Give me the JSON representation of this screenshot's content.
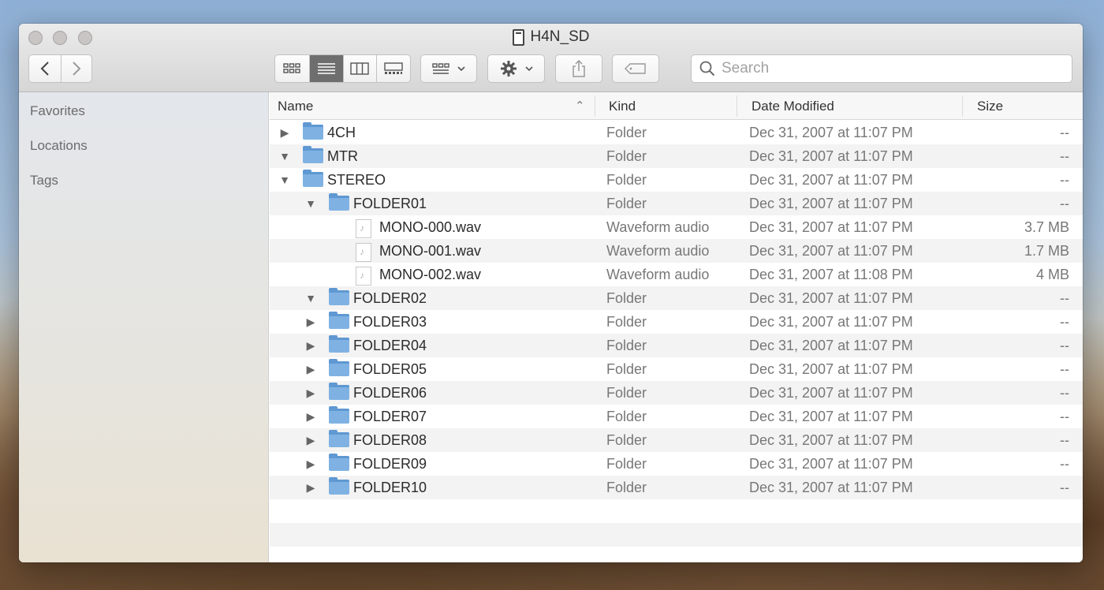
{
  "window": {
    "title": "H4N_SD"
  },
  "toolbar": {
    "back_icon": "chevron-left-icon",
    "forward_icon": "chevron-right-icon",
    "search_placeholder": "Search"
  },
  "sidebar": {
    "sections": [
      {
        "label": "Favorites"
      },
      {
        "label": "Locations"
      },
      {
        "label": "Tags"
      }
    ]
  },
  "columns": {
    "name": "Name",
    "kind": "Kind",
    "date": "Date Modified",
    "size": "Size"
  },
  "rows": [
    {
      "name": "4CH",
      "kind": "Folder",
      "date": "Dec 31, 2007 at 11:07 PM",
      "size": "--",
      "type": "folder",
      "level": 0,
      "expanded": false
    },
    {
      "name": "MTR",
      "kind": "Folder",
      "date": "Dec 31, 2007 at 11:07 PM",
      "size": "--",
      "type": "folder",
      "level": 0,
      "expanded": true
    },
    {
      "name": "STEREO",
      "kind": "Folder",
      "date": "Dec 31, 2007 at 11:07 PM",
      "size": "--",
      "type": "folder",
      "level": 0,
      "expanded": true
    },
    {
      "name": "FOLDER01",
      "kind": "Folder",
      "date": "Dec 31, 2007 at 11:07 PM",
      "size": "--",
      "type": "folder",
      "level": 1,
      "expanded": true
    },
    {
      "name": "MONO-000.wav",
      "kind": "Waveform audio",
      "date": "Dec 31, 2007 at 11:07 PM",
      "size": "3.7 MB",
      "type": "file",
      "level": 2
    },
    {
      "name": "MONO-001.wav",
      "kind": "Waveform audio",
      "date": "Dec 31, 2007 at 11:07 PM",
      "size": "1.7 MB",
      "type": "file",
      "level": 2
    },
    {
      "name": "MONO-002.wav",
      "kind": "Waveform audio",
      "date": "Dec 31, 2007 at 11:08 PM",
      "size": "4 MB",
      "type": "file",
      "level": 2
    },
    {
      "name": "FOLDER02",
      "kind": "Folder",
      "date": "Dec 31, 2007 at 11:07 PM",
      "size": "--",
      "type": "folder",
      "level": 1,
      "expanded": true
    },
    {
      "name": "FOLDER03",
      "kind": "Folder",
      "date": "Dec 31, 2007 at 11:07 PM",
      "size": "--",
      "type": "folder",
      "level": 1,
      "expanded": false
    },
    {
      "name": "FOLDER04",
      "kind": "Folder",
      "date": "Dec 31, 2007 at 11:07 PM",
      "size": "--",
      "type": "folder",
      "level": 1,
      "expanded": false
    },
    {
      "name": "FOLDER05",
      "kind": "Folder",
      "date": "Dec 31, 2007 at 11:07 PM",
      "size": "--",
      "type": "folder",
      "level": 1,
      "expanded": false
    },
    {
      "name": "FOLDER06",
      "kind": "Folder",
      "date": "Dec 31, 2007 at 11:07 PM",
      "size": "--",
      "type": "folder",
      "level": 1,
      "expanded": false
    },
    {
      "name": "FOLDER07",
      "kind": "Folder",
      "date": "Dec 31, 2007 at 11:07 PM",
      "size": "--",
      "type": "folder",
      "level": 1,
      "expanded": false
    },
    {
      "name": "FOLDER08",
      "kind": "Folder",
      "date": "Dec 31, 2007 at 11:07 PM",
      "size": "--",
      "type": "folder",
      "level": 1,
      "expanded": false
    },
    {
      "name": "FOLDER09",
      "kind": "Folder",
      "date": "Dec 31, 2007 at 11:07 PM",
      "size": "--",
      "type": "folder",
      "level": 1,
      "expanded": false
    },
    {
      "name": "FOLDER10",
      "kind": "Folder",
      "date": "Dec 31, 2007 at 11:07 PM",
      "size": "--",
      "type": "folder",
      "level": 1,
      "expanded": false
    }
  ]
}
